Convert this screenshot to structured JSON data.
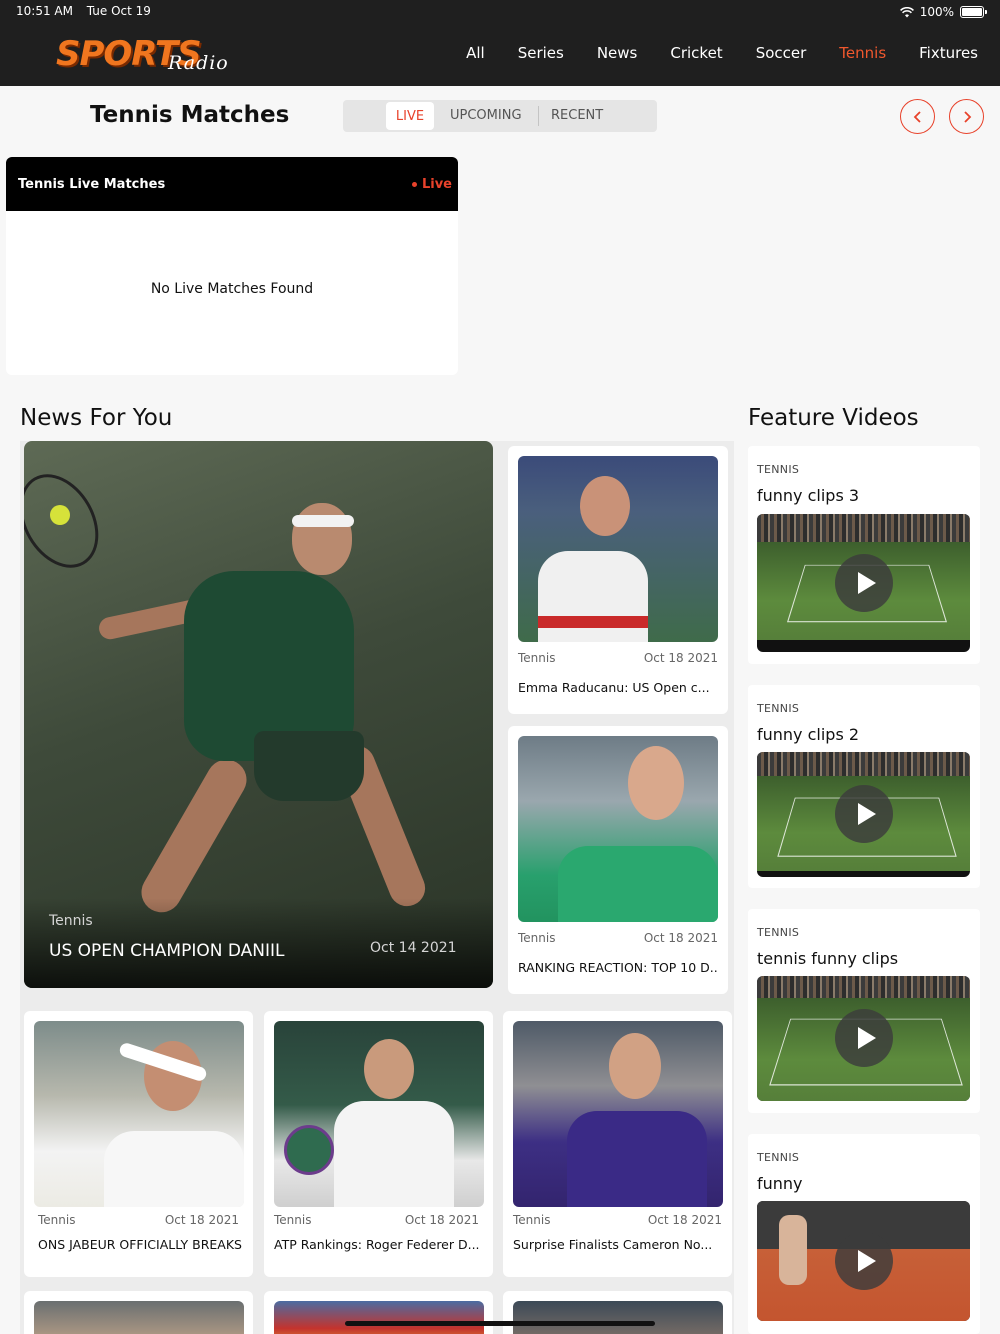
{
  "status_bar": {
    "time": "10:51 AM",
    "date": "Tue Oct 19",
    "battery": "100%",
    "battery_level": 1.0
  },
  "brand": {
    "logo_main": "SPORTS",
    "logo_sub": "Radio",
    "accent_color": "#f0761f"
  },
  "nav": {
    "items": [
      "All",
      "Series",
      "News",
      "Cricket",
      "Soccer",
      "Tennis",
      "Fixtures"
    ],
    "active": "Tennis",
    "active_color": "#f0582e"
  },
  "matches": {
    "title": "Tennis Matches",
    "tabs": [
      "LIVE",
      "UPCOMING",
      "RECENT"
    ],
    "active_tab": "LIVE",
    "prev_icon": "chevron-left-icon",
    "next_icon": "chevron-right-icon"
  },
  "live_card": {
    "title": "Tennis Live Matches",
    "live_label": "Live",
    "empty_text": "No Live Matches Found"
  },
  "news": {
    "section_title": "News For You",
    "hero": {
      "category": "Tennis",
      "title": "US OPEN CHAMPION DANIIL",
      "date": "Oct 14 2021"
    },
    "side": [
      {
        "category": "Tennis",
        "date": "Oct 18 2021",
        "title": "Emma Raducanu: US Open c..."
      },
      {
        "category": "Tennis",
        "date": "Oct 18 2021",
        "title": "RANKING REACTION: TOP 10 D..."
      }
    ],
    "row": [
      {
        "category": "Tennis",
        "date": "Oct 18 2021",
        "title": "ONS JABEUR OFFICIALLY BREAKS..."
      },
      {
        "category": "Tennis",
        "date": "Oct 18 2021",
        "title": "ATP Rankings: Roger Federer D..."
      },
      {
        "category": "Tennis",
        "date": "Oct 18 2021",
        "title": "Surprise Finalists Cameron No..."
      }
    ]
  },
  "videos": {
    "section_title": "Feature Videos",
    "items": [
      {
        "category": "TENNIS",
        "title": "funny clips 3"
      },
      {
        "category": "TENNIS",
        "title": "funny clips 2"
      },
      {
        "category": "TENNIS",
        "title": "tennis funny clips"
      },
      {
        "category": "TENNIS",
        "title": "funny"
      }
    ],
    "play_icon": "play-icon"
  }
}
